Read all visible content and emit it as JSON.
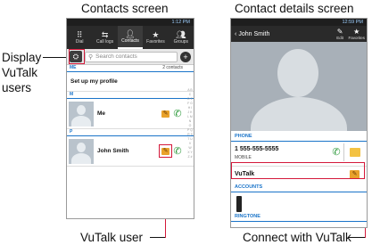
{
  "captions": {
    "contacts_screen": "Contacts screen",
    "details_screen": "Contact details screen"
  },
  "callouts": {
    "display_users": "Display VuTalk users",
    "vutalk_user": "VuTalk user",
    "connect": "Connect with VuTalk"
  },
  "contacts": {
    "status_time": "1:12 PM",
    "tabs": [
      {
        "label": "Dial",
        "icon": "grid-icon"
      },
      {
        "label": "Call logs",
        "icon": "call-logs-icon"
      },
      {
        "label": "Contacts",
        "icon": "person-icon",
        "active": true
      },
      {
        "label": "Favorites",
        "icon": "star-icon"
      },
      {
        "label": "Groups",
        "icon": "groups-icon"
      }
    ],
    "search_placeholder": "Search contacts",
    "sections": {
      "me": "ME",
      "me_count": "2 contacts",
      "m": "M",
      "p": "P"
    },
    "setup_profile": "Set up my profile",
    "rows": [
      {
        "name": "Me"
      },
      {
        "name": "John Smith"
      }
    ],
    "index_letters": "A B C D E F G H I J K L M N O P Q R S T U V W X Y Z #"
  },
  "details": {
    "status_time": "12:59 PM",
    "back_label": "John Smith",
    "edit_label": "Edit",
    "favorites_label": "Favorites",
    "phone_section": "PHONE",
    "phone_number": "1 555-555-5555",
    "phone_type": "MOBILE",
    "vutalk_label": "VuTalk",
    "accounts_section": "ACCOUNTS",
    "ringtone_section": "RINGTONE"
  },
  "colors": {
    "accent_blue": "#1a74c9",
    "callout_red": "#d4183a",
    "vutalk_orange": "#e9a22b",
    "call_green": "#2e9a3c"
  }
}
